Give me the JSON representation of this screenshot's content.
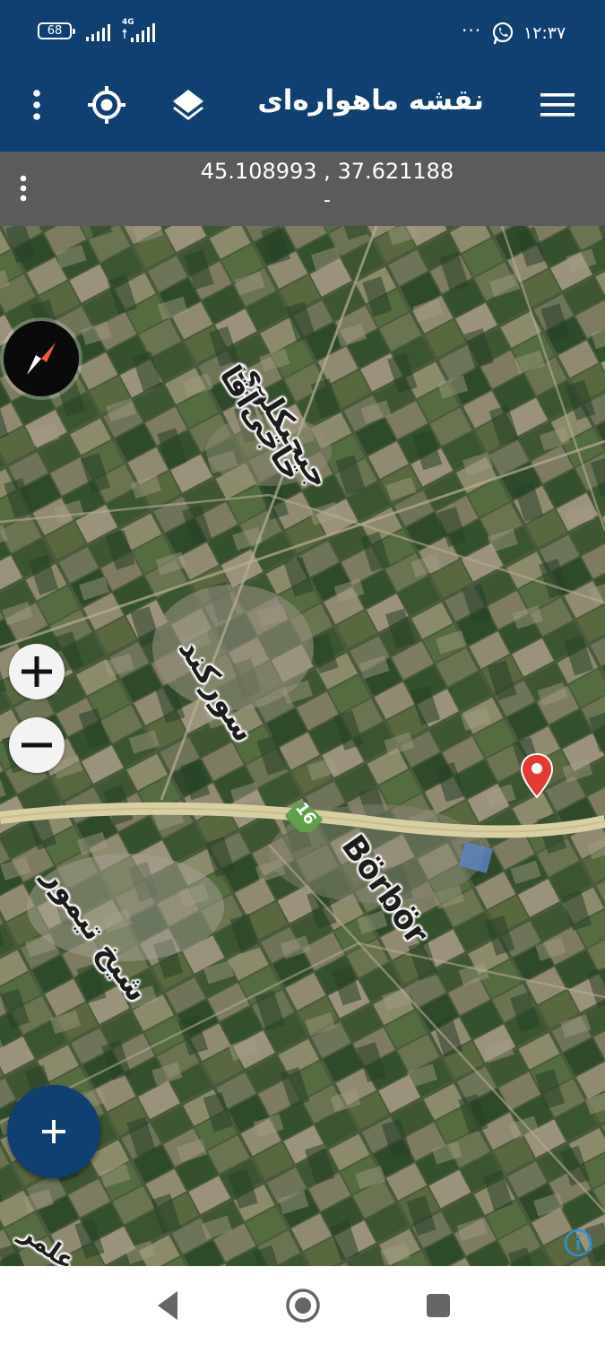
{
  "status_bar": {
    "battery": "68",
    "network": "4G",
    "dots": "···",
    "time": "۱۲:۳۷",
    "icons": [
      "signal-icon",
      "signal-4g-icon",
      "whatsapp-icon"
    ]
  },
  "app_bar": {
    "title": "نقشه ماهواره‌ای",
    "icons": [
      "menu-icon",
      "layers-icon",
      "my-location-icon",
      "more-vert-icon"
    ]
  },
  "coordinates": {
    "value": "45.108993 , 37.621188",
    "subtitle": "-"
  },
  "map": {
    "labels": {
      "village_1": "جیجیکلوی",
      "village_1b": "حاجی‌آقا",
      "village_2": "سورکند",
      "village_3": "شیخ تیمور",
      "road_name": "Börbör",
      "edge_fragment": "علمر"
    },
    "road_number": "16",
    "colors": {
      "road": "#d8cfa3",
      "badge": "#5fa04b",
      "pin": "#e53935",
      "primary": "#0f4071"
    }
  },
  "controls": {
    "zoom_in": "+",
    "zoom_out": "−",
    "fab": "+"
  }
}
